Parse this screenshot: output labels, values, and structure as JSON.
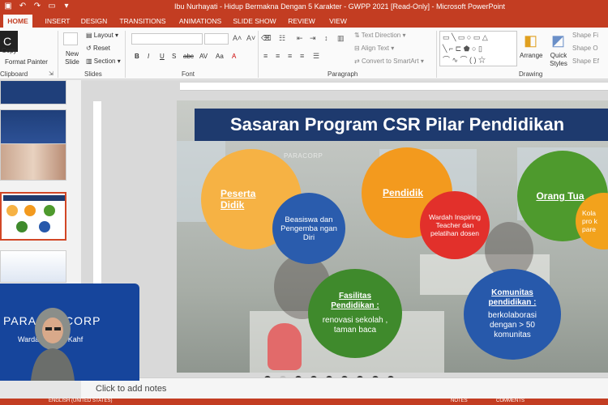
{
  "window": {
    "title": "Ibu Nurhayati - Hidup Bermakna Dengan 5 Karakter - GWPP 2021 [Read-Only] - Microsoft PowerPoint"
  },
  "tabs": [
    "HOME",
    "INSERT",
    "DESIGN",
    "TRANSITIONS",
    "ANIMATIONS",
    "SLIDE SHOW",
    "REVIEW",
    "VIEW"
  ],
  "clipboard": {
    "copy_label": "Copy",
    "format_painter_label": "Format Painter",
    "group_label": "Clipboard"
  },
  "slides_group": {
    "new_slide_label": "New Slide",
    "layout_label": "Layout",
    "reset_label": "Reset",
    "section_label": "Section",
    "group_label": "Slides"
  },
  "font_group": {
    "group_label": "Font",
    "bold": "B",
    "italic": "I",
    "underline": "U",
    "strike": "S",
    "abc": "abc",
    "av": "AV",
    "aa": "Aa",
    "a": "A"
  },
  "paragraph_group": {
    "group_label": "Paragraph",
    "text_direction_label": "Text Direction",
    "align_text_label": "Align Text",
    "convert_smartart_label": "Convert to SmartArt"
  },
  "drawing_group": {
    "group_label": "Drawing",
    "arrange_label": "Arrange",
    "quick_styles_label": "Quick Styles",
    "shape_fill_label": "Shape Fi",
    "shape_outline_label": "Shape O",
    "shape_effects_label": "Shape Ef"
  },
  "slide": {
    "title": "Sasaran Program CSR Pilar Pendidikan",
    "watermark": "PARACORP",
    "circles": [
      {
        "head": "Peserta Didik",
        "color": "#f6b244"
      },
      {
        "head": "",
        "body": "Beasiswa dan Pengemba ngan Diri",
        "color": "#2a5cad"
      },
      {
        "head": "Pendidik",
        "color": "#f39a1e"
      },
      {
        "head": "",
        "body": "Wardah Inspiring Teacher dan pelatihan dosen",
        "color": "#e2302b"
      },
      {
        "head": "Orang Tua",
        "color": "#4e9a2d"
      },
      {
        "head": "",
        "body": "Kola pro k pare",
        "color": "#f2a21c"
      },
      {
        "head": "Fasilitas Pendidikan :",
        "body": "renovasi sekolah , taman baca",
        "color": "#3f8a2c"
      },
      {
        "head": "Komunitas pendidikan :",
        "body": "berkolaborasi dengan > 50 komunitas",
        "color": "#2759ab"
      }
    ]
  },
  "notes": {
    "placeholder": "Click to add notes"
  },
  "status": {
    "language": "ENGLISH (UNITED STATES)",
    "notes": "NOTES",
    "comments": "COMMENTS"
  },
  "webcam": {
    "brand": "PARAGONCORP",
    "sub": "Wardah  Emina  Kahf"
  },
  "slide_nav": {
    "count": 9,
    "current": 1
  }
}
